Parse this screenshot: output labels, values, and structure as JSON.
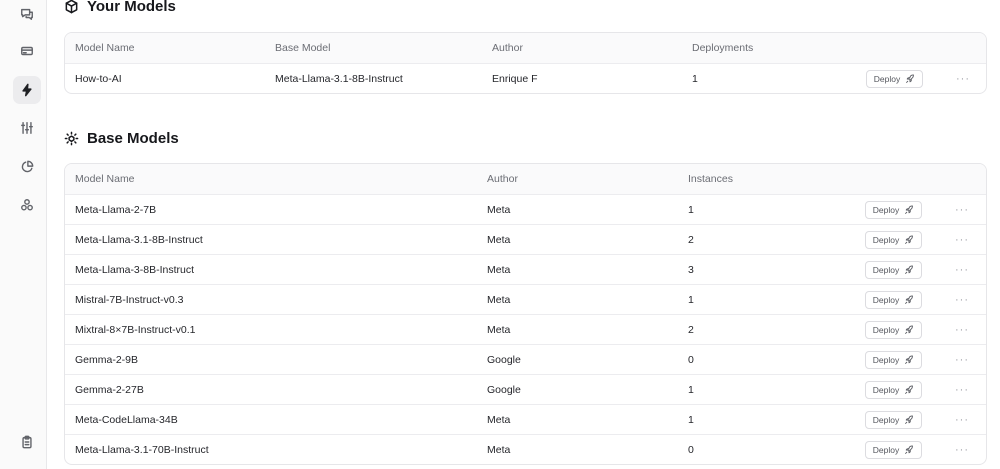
{
  "sidebar": {
    "icons": [
      "chat-icon",
      "card-icon",
      "bolt-icon",
      "sliders-icon",
      "pie-chart-icon",
      "circles-icon",
      "clipboard-icon"
    ]
  },
  "your_models": {
    "title": "Your Models",
    "headers": {
      "name": "Model Name",
      "base": "Base Model",
      "author": "Author",
      "deployments": "Deployments"
    },
    "rows": [
      {
        "name": "How-to-AI",
        "base": "Meta-Llama-3.1-8B-Instruct",
        "author": "Enrique F",
        "deployments": "1",
        "deploy": "Deploy",
        "more": "···"
      }
    ]
  },
  "base_models": {
    "title": "Base Models",
    "headers": {
      "name": "Model Name",
      "author": "Author",
      "instances": "Instances"
    },
    "rows": [
      {
        "name": "Meta-Llama-2-7B",
        "author": "Meta",
        "instances": "1",
        "deploy": "Deploy",
        "more": "···"
      },
      {
        "name": "Meta-Llama-3.1-8B-Instruct",
        "author": "Meta",
        "instances": "2",
        "deploy": "Deploy",
        "more": "···"
      },
      {
        "name": "Meta-Llama-3-8B-Instruct",
        "author": "Meta",
        "instances": "3",
        "deploy": "Deploy",
        "more": "···"
      },
      {
        "name": "Mistral-7B-Instruct-v0.3",
        "author": "Meta",
        "instances": "1",
        "deploy": "Deploy",
        "more": "···"
      },
      {
        "name": "Mixtral-8×7B-Instruct-v0.1",
        "author": "Meta",
        "instances": "2",
        "deploy": "Deploy",
        "more": "···"
      },
      {
        "name": "Gemma-2-9B",
        "author": "Google",
        "instances": "0",
        "deploy": "Deploy",
        "more": "···"
      },
      {
        "name": "Gemma-2-27B",
        "author": "Google",
        "instances": "1",
        "deploy": "Deploy",
        "more": "···"
      },
      {
        "name": "Meta-CodeLlama-34B",
        "author": "Meta",
        "instances": "1",
        "deploy": "Deploy",
        "more": "···"
      },
      {
        "name": "Meta-Llama-3.1-70B-Instruct",
        "author": "Meta",
        "instances": "0",
        "deploy": "Deploy",
        "more": "···"
      }
    ]
  }
}
